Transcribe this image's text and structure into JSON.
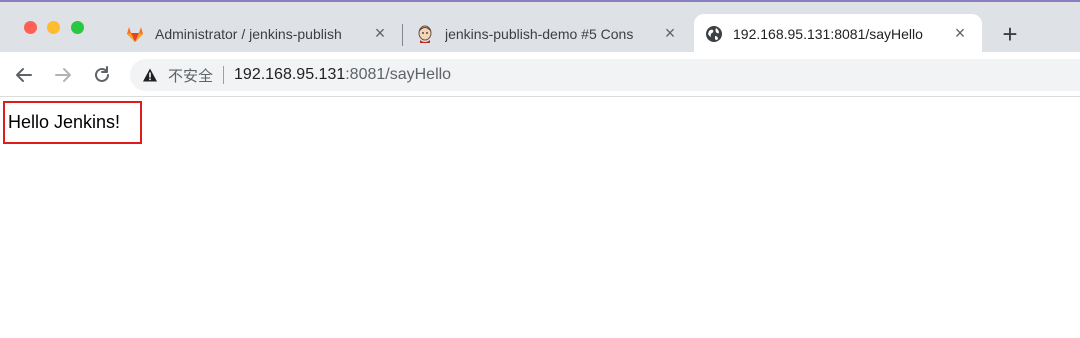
{
  "browser": {
    "tabs": [
      {
        "title": "Administrator / jenkins-publish",
        "icon": "gitlab-icon",
        "active": false
      },
      {
        "title": "jenkins-publish-demo #5 Cons",
        "icon": "jenkins-icon",
        "active": false
      },
      {
        "title": "192.168.95.131:8081/sayHello",
        "icon": "globe-icon",
        "active": true
      }
    ],
    "new_tab_label": "+",
    "close_glyph": "×",
    "address": {
      "security_label": "不安全",
      "host": "192.168.95.131",
      "rest": ":8081/sayHello"
    }
  },
  "page": {
    "body_text": "Hello Jenkins!"
  },
  "colors": {
    "highlight_border": "#e01b1b",
    "tabstrip": "#dee1e6"
  }
}
